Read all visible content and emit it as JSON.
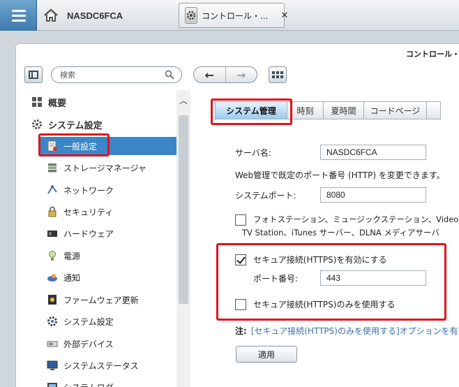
{
  "topbar": {
    "home_label": "NASDC6FCA",
    "tab": {
      "title": "コントロール・...",
      "close": "✕"
    }
  },
  "window": {
    "title": "コントロール・",
    "search": {
      "placeholder": "検索"
    },
    "nav": {
      "back": "←",
      "forward": "→"
    }
  },
  "sidebar": {
    "overview": "概要",
    "system_settings": "システム設定",
    "items": [
      {
        "label": "一般設定",
        "icon": "general-settings-icon",
        "selected": true
      },
      {
        "label": "ストレージマネージャ",
        "icon": "storage-icon"
      },
      {
        "label": "ネットワーク",
        "icon": "network-icon"
      },
      {
        "label": "セキュリティ",
        "icon": "lock-icon"
      },
      {
        "label": "ハードウェア",
        "icon": "hardware-icon"
      },
      {
        "label": "電源",
        "icon": "power-bulb-icon"
      },
      {
        "label": "通知",
        "icon": "notification-icon"
      },
      {
        "label": "ファームウェア更新",
        "icon": "firmware-icon"
      },
      {
        "label": "システム設定",
        "icon": "system-settings-icon"
      },
      {
        "label": "外部デバイス",
        "icon": "external-device-icon"
      },
      {
        "label": "システムステータス",
        "icon": "monitor-icon"
      },
      {
        "label": "システムログ",
        "icon": "log-icon"
      }
    ]
  },
  "main": {
    "tabs": [
      "システム管理",
      "時刻",
      "夏時間",
      "コードページ",
      ""
    ],
    "server_name_label": "サーバ名:",
    "server_name_value": "NASDC6FCA",
    "http_port_desc": "Web管理で既定のポート番号 (HTTP) を変更できます。",
    "system_port_label": "システムポート:",
    "system_port_value": "8080",
    "photo_station_line1": "フォトステーション、ミュージックステーション、Video Sta",
    "photo_station_line2": "TV Station、iTunes サーバー、DLNA メディアサーバ",
    "https_enable_label": "セキュア接続(HTTPS)を有効にする",
    "https_enable_checked": true,
    "port_label": "ポート番号:",
    "port_value": "443",
    "https_only_label": "セキュア接続(HTTPS)のみを使用する",
    "https_only_checked": false,
    "note_prefix": "注:",
    "note_text": "[セキュア接続(HTTPS)のみを使用する]オプションを有効",
    "apply_label": "適用"
  },
  "colors": {
    "accent": "#3a86c8",
    "highlight": "#e0121c",
    "menu_blue": "#4a88b8"
  }
}
